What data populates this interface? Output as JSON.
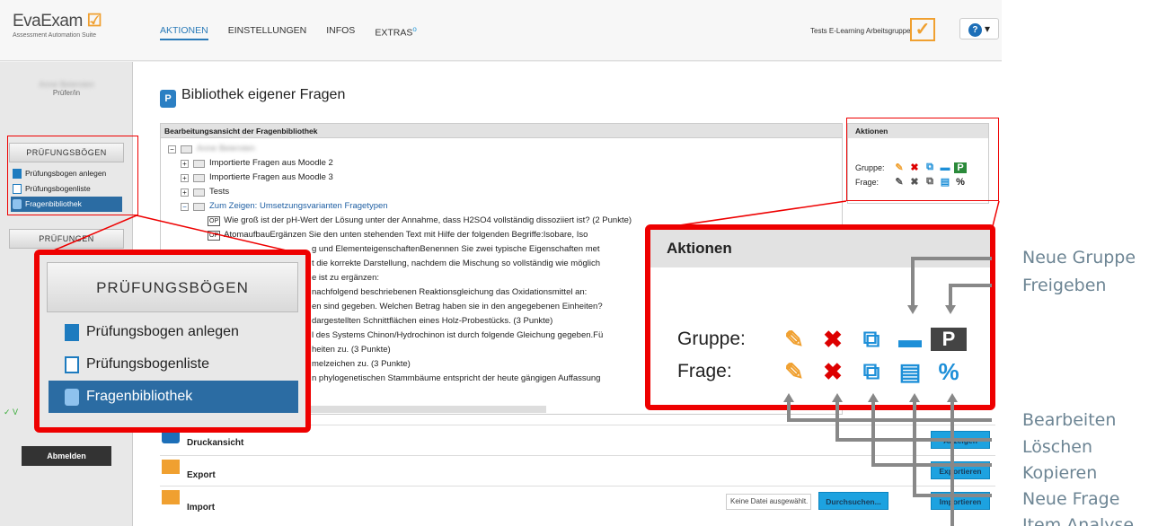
{
  "header": {
    "logo_brand": "EvaExam",
    "logo_tagline": "Assessment Automation Suite",
    "nav": [
      "AKTIONEN",
      "EINSTELLUNGEN",
      "INFOS",
      "EXTRAS"
    ],
    "group_name": "Tests E-Learning Arbeitsgruppe",
    "help_label": "?"
  },
  "sidebar": {
    "user_name": "Anne Beiersten",
    "user_role": "Prüfer/in",
    "section1": "PRÜFUNGSBÖGEN",
    "items": [
      "Prüfungsbogen anlegen",
      "Prüfungsbogenliste",
      "Fragenbibliothek"
    ],
    "section2": "PRÜFUNGEN",
    "logout": "Abmelden"
  },
  "main": {
    "title": "Bibliothek eigener Fragen",
    "table_header": "Bearbeitungsansicht der Fragenbibliothek",
    "actions_header": "Aktionen",
    "row_gruppe": "Gruppe:",
    "row_frage": "Frage:",
    "tree_root": "Anne Beiersten",
    "tree": [
      "Importierte Fragen aus Moodle 2",
      "Importierte Fragen aus Moodle 3",
      "Tests",
      "Zum Zeigen: Umsetzungsvarianten Fragetypen"
    ],
    "questions": [
      "Wie groß ist der pH-Wert der Lösung unter der Annahme, dass H2SO4 vollständig dissoziiert ist? (2 Punkte)",
      "AtomaufbauErgänzen Sie den unten stehenden Text mit Hilfe der folgenden Begriffe:Isobare, Iso",
      "g und ElementeigenschaftenBenennen Sie zwei typische Eigenschaften met",
      "t die korrekte Darstellung, nachdem die Mischung so vollständig wie möglich",
      "e ist zu ergänzen:",
      "nachfolgend beschriebenen Reaktionsgleichung das Oxidationsmittel an:",
      "en sind gegeben. Welchen Betrag haben sie in den angegebenen Einheiten?",
      "dargestellten Schnittflächen eines Holz-Probestücks. (3 Punkte)",
      "l des Systems Chinon/Hydrochinon ist durch folgende Gleichung gegeben.Fü",
      "heiten zu. (3 Punkte)",
      "melzeichen zu. (3 Punkte)",
      "n phylogenetischen Stammbäume entspricht der heute gängigen Auffassung"
    ],
    "op_tag": "OP",
    "bars": [
      {
        "label": "Druckansicht",
        "button": "Anzeigen"
      },
      {
        "label": "Export",
        "button": "Exportieren"
      },
      {
        "label": "Import",
        "button": "Importieren"
      }
    ],
    "file_placeholder": "Keine Datei ausgewählt.",
    "browse": "Durchsuchen..."
  },
  "annotations": [
    "Neue Gruppe",
    "Freigeben",
    "Bearbeiten",
    "Löschen",
    "Kopieren",
    "Neue Frage",
    "Item Analyse"
  ],
  "colors": {
    "accent": "#2b6ca3",
    "highlight": "#ee0000",
    "button": "#1da2e0",
    "annotation": "#6d8594"
  }
}
